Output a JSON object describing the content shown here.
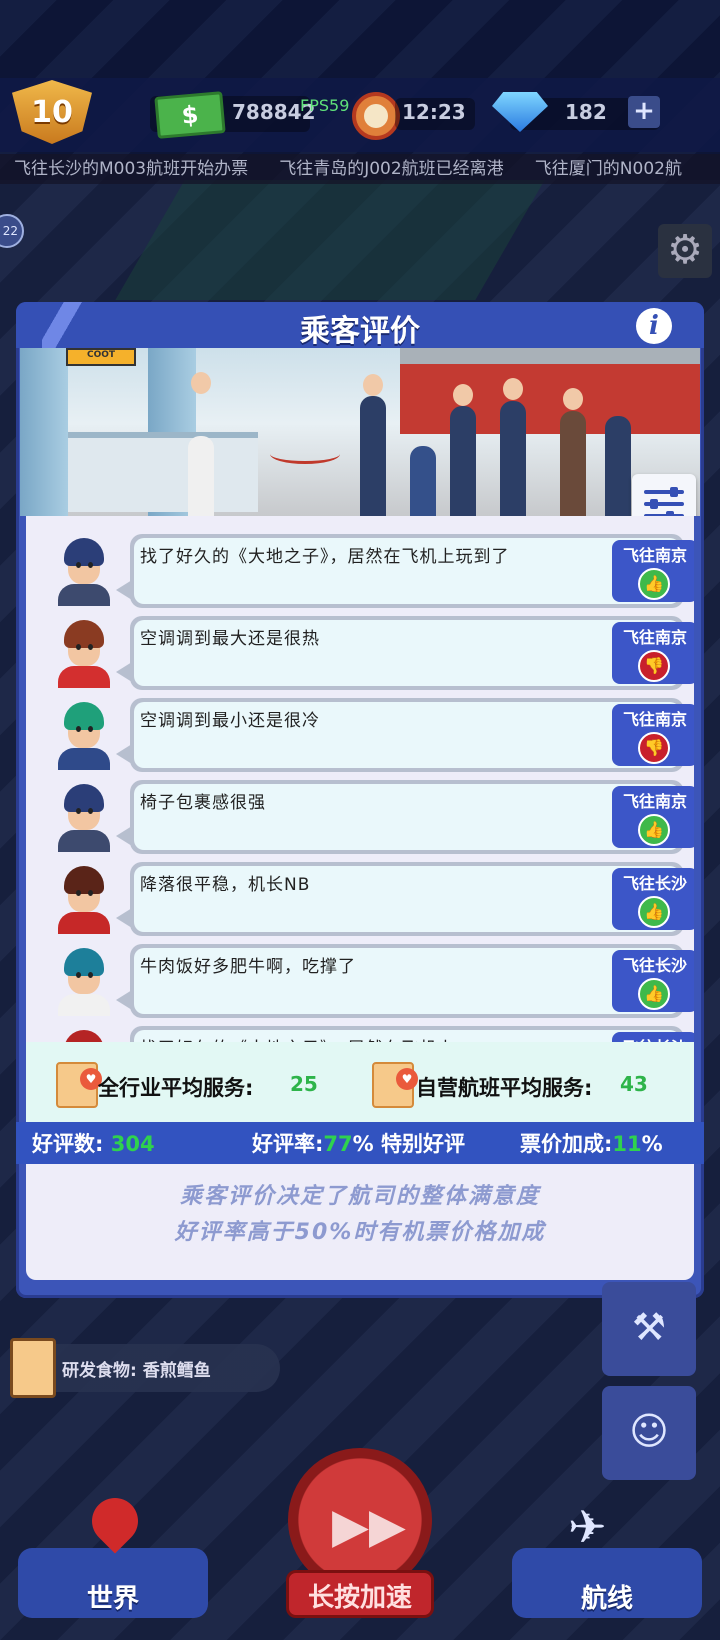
{
  "hud": {
    "level": "10",
    "money_symbol": "$",
    "money": "788842",
    "fps": "FPS59",
    "time": "12:23",
    "gems": "182",
    "plus": "+"
  },
  "ticker": [
    "飞往长沙的M003航班开始办票",
    "飞往青岛的J002航班已经离港",
    "飞往厦门的N002航"
  ],
  "left_indicator": "22",
  "panel": {
    "title": "乘客评价",
    "info_icon": "i",
    "banner_sign": "COOT",
    "reviews": [
      {
        "text": "找了好久的《大地之子》，居然在飞机上玩到了",
        "dest": "飞往南京",
        "rating": "good",
        "hair": "#2b3e78",
        "shirt": "#3d4a6e"
      },
      {
        "text": "空调调到最大还是很热",
        "dest": "飞往南京",
        "rating": "bad",
        "hair": "#8a3b22",
        "shirt": "#d32f2f"
      },
      {
        "text": "空调调到最小还是很冷",
        "dest": "飞往南京",
        "rating": "bad",
        "hair": "#1fa07a",
        "shirt": "#2f4a8a"
      },
      {
        "text": "椅子包裹感很强",
        "dest": "飞往南京",
        "rating": "good",
        "hair": "#2b3e78",
        "shirt": "#3d4a6e"
      },
      {
        "text": "降落很平稳，机长NB",
        "dest": "飞往长沙",
        "rating": "good",
        "hair": "#5a2418",
        "shirt": "#c62828"
      },
      {
        "text": "牛肉饭好多肥牛啊，吃撑了",
        "dest": "飞往长沙",
        "rating": "good",
        "hair": "#1d7f9a",
        "shirt": "#f1f1f1"
      },
      {
        "text": "找了好久的《大地之子》，居然在飞机上",
        "dest": "飞往长沙",
        "rating": "good",
        "hair": "#b52424",
        "shirt": "#2f4a8a"
      }
    ],
    "stats": {
      "industry_label": "全行业平均服务:",
      "industry_value": "25",
      "own_label": "自营航班平均服务:",
      "own_value": "43"
    },
    "rating_bar": {
      "good_count_label": "好评数:",
      "good_count_value": "304",
      "good_rate_label": "好评率:",
      "good_rate_value": "77",
      "good_rate_suffix": "% 特别好评",
      "price_bonus_label": "票价加成:",
      "price_bonus_value": "11",
      "price_bonus_suffix": "%"
    },
    "footer": [
      "乘客评价决定了航司的整体满意度",
      "好评率高于50%时有机票价格加成"
    ]
  },
  "research": "研发食物: 香煎鳕鱼",
  "bottom_nav": {
    "world": "世界",
    "speed": "长按加速",
    "routes": "航线"
  },
  "icons": {
    "level": "shield-badge-icon",
    "money": "cash-icon",
    "clock": "alarm-clock-icon",
    "gem": "diamond-icon",
    "settings": "gear-icon",
    "info": "info-icon",
    "filter": "sliders-icon",
    "thumb_up": "thumbs-up-icon",
    "thumb_down": "thumbs-down-icon"
  },
  "colors": {
    "panel": "#3c55b8",
    "good": "#3fb94a",
    "bad": "#c8202c",
    "value_green": "#2fd24e"
  }
}
